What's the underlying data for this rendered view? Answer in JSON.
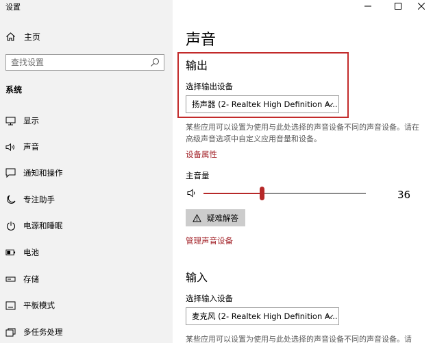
{
  "window": {
    "title": "设置"
  },
  "sidebar": {
    "home_label": "主页",
    "search_placeholder": "查找设置",
    "section_label": "系统",
    "items": [
      {
        "label": "显示",
        "icon": "monitor-icon"
      },
      {
        "label": "声音",
        "icon": "speaker-icon"
      },
      {
        "label": "通知和操作",
        "icon": "notification-icon"
      },
      {
        "label": "专注助手",
        "icon": "moon-icon"
      },
      {
        "label": "电源和睡眠",
        "icon": "power-icon"
      },
      {
        "label": "电池",
        "icon": "battery-icon"
      },
      {
        "label": "存储",
        "icon": "storage-icon"
      },
      {
        "label": "平板模式",
        "icon": "tablet-icon"
      },
      {
        "label": "多任务处理",
        "icon": "multitask-icon"
      }
    ]
  },
  "main": {
    "title": "声音",
    "output": {
      "heading": "输出",
      "device_label": "选择输出设备",
      "device_value": "扬声器 (2- Realtek High Definition A...",
      "description": "某些应用可以设置为使用与此处选择的声音设备不同的声音设备。请在高级声音选项中自定义应用音量和设备。",
      "properties_link": "设备属性",
      "volume_label": "主音量",
      "volume_value": "36",
      "volume_percent": 36,
      "troubleshoot_label": "疑难解答",
      "manage_link": "管理声音设备"
    },
    "input": {
      "heading": "输入",
      "device_label": "选择输入设备",
      "device_value": "麦克风 (2- Realtek High Definition A...",
      "description": "某些应用可以设置为使用与此处选择的声音设备不同的声音设备。请"
    }
  },
  "colors": {
    "accent": "#b62828",
    "highlight_border": "#c22a2a",
    "sidebar_bg": "#f2f2f2"
  }
}
